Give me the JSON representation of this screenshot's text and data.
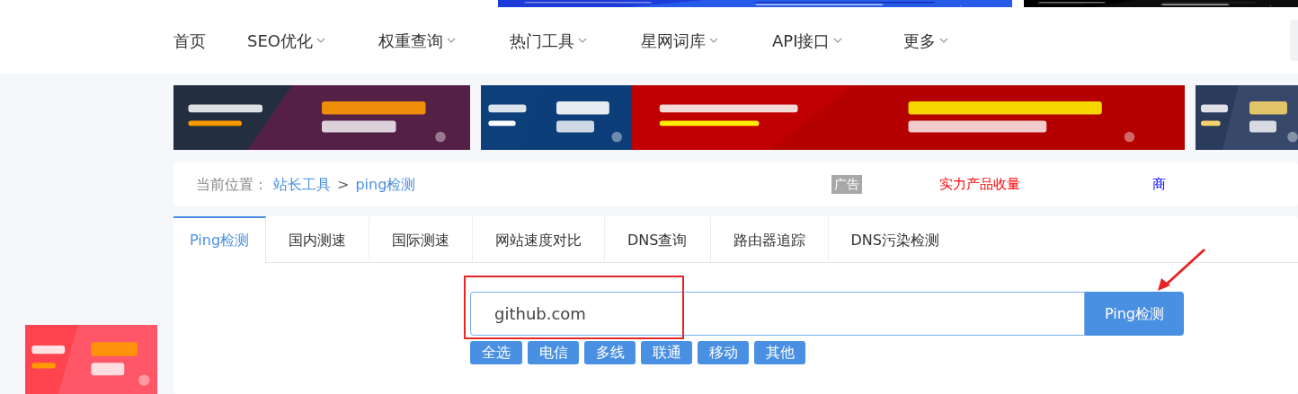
{
  "nav": [
    {
      "label": "首页",
      "dropdown": false
    },
    {
      "label": "SEO优化",
      "dropdown": true
    },
    {
      "label": "权重查询",
      "dropdown": true
    },
    {
      "label": "热门工具",
      "dropdown": true
    },
    {
      "label": "星网词库",
      "dropdown": true
    },
    {
      "label": "API接口",
      "dropdown": true
    },
    {
      "label": "更多",
      "dropdown": true
    }
  ],
  "breadcrumb": {
    "prefix": "当前位置：",
    "items": [
      "站长工具",
      "ping检测"
    ],
    "separator": ">"
  },
  "ad_links": [
    {
      "kind": "tag",
      "text": "广告"
    },
    {
      "kind": "link",
      "text": "实力产品收量",
      "color": "#ff0000"
    },
    {
      "kind": "link",
      "text": "商",
      "color": "#0000ff"
    }
  ],
  "tabs": [
    {
      "label": "Ping检测",
      "selected": true
    },
    {
      "label": "国内测速",
      "selected": false
    },
    {
      "label": "国际测速",
      "selected": false
    },
    {
      "label": "网站速度对比",
      "selected": false
    },
    {
      "label": "DNS查询",
      "selected": false
    },
    {
      "label": "路由器追踪",
      "selected": false
    },
    {
      "label": "DNS污染检测",
      "selected": false
    }
  ],
  "search": {
    "value": "github.com",
    "button": "Ping检测"
  },
  "filters": [
    "全选",
    "电信",
    "多线",
    "联通",
    "移动",
    "其他"
  ]
}
